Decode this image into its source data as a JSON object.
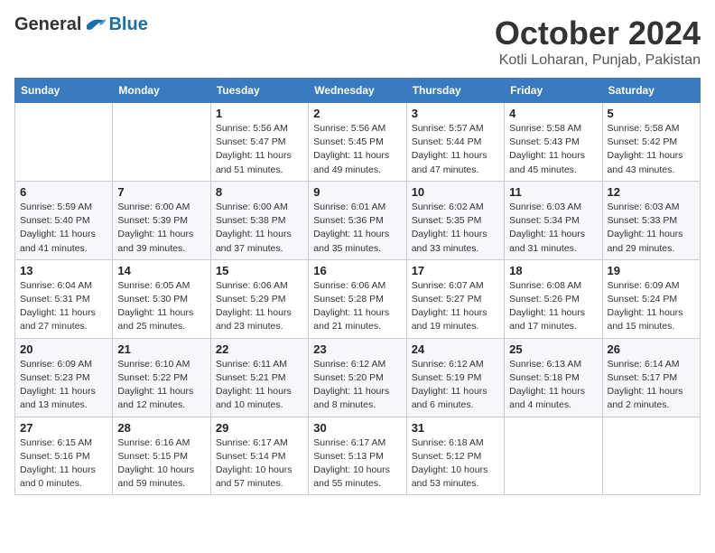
{
  "header": {
    "logo": {
      "general": "General",
      "blue": "Blue"
    },
    "title": "October 2024",
    "location": "Kotli Loharan, Punjab, Pakistan"
  },
  "calendar": {
    "columns": [
      "Sunday",
      "Monday",
      "Tuesday",
      "Wednesday",
      "Thursday",
      "Friday",
      "Saturday"
    ],
    "rows": [
      [
        {
          "day": "",
          "info": ""
        },
        {
          "day": "",
          "info": ""
        },
        {
          "day": "1",
          "info": "Sunrise: 5:56 AM\nSunset: 5:47 PM\nDaylight: 11 hours and 51 minutes."
        },
        {
          "day": "2",
          "info": "Sunrise: 5:56 AM\nSunset: 5:45 PM\nDaylight: 11 hours and 49 minutes."
        },
        {
          "day": "3",
          "info": "Sunrise: 5:57 AM\nSunset: 5:44 PM\nDaylight: 11 hours and 47 minutes."
        },
        {
          "day": "4",
          "info": "Sunrise: 5:58 AM\nSunset: 5:43 PM\nDaylight: 11 hours and 45 minutes."
        },
        {
          "day": "5",
          "info": "Sunrise: 5:58 AM\nSunset: 5:42 PM\nDaylight: 11 hours and 43 minutes."
        }
      ],
      [
        {
          "day": "6",
          "info": "Sunrise: 5:59 AM\nSunset: 5:40 PM\nDaylight: 11 hours and 41 minutes."
        },
        {
          "day": "7",
          "info": "Sunrise: 6:00 AM\nSunset: 5:39 PM\nDaylight: 11 hours and 39 minutes."
        },
        {
          "day": "8",
          "info": "Sunrise: 6:00 AM\nSunset: 5:38 PM\nDaylight: 11 hours and 37 minutes."
        },
        {
          "day": "9",
          "info": "Sunrise: 6:01 AM\nSunset: 5:36 PM\nDaylight: 11 hours and 35 minutes."
        },
        {
          "day": "10",
          "info": "Sunrise: 6:02 AM\nSunset: 5:35 PM\nDaylight: 11 hours and 33 minutes."
        },
        {
          "day": "11",
          "info": "Sunrise: 6:03 AM\nSunset: 5:34 PM\nDaylight: 11 hours and 31 minutes."
        },
        {
          "day": "12",
          "info": "Sunrise: 6:03 AM\nSunset: 5:33 PM\nDaylight: 11 hours and 29 minutes."
        }
      ],
      [
        {
          "day": "13",
          "info": "Sunrise: 6:04 AM\nSunset: 5:31 PM\nDaylight: 11 hours and 27 minutes."
        },
        {
          "day": "14",
          "info": "Sunrise: 6:05 AM\nSunset: 5:30 PM\nDaylight: 11 hours and 25 minutes."
        },
        {
          "day": "15",
          "info": "Sunrise: 6:06 AM\nSunset: 5:29 PM\nDaylight: 11 hours and 23 minutes."
        },
        {
          "day": "16",
          "info": "Sunrise: 6:06 AM\nSunset: 5:28 PM\nDaylight: 11 hours and 21 minutes."
        },
        {
          "day": "17",
          "info": "Sunrise: 6:07 AM\nSunset: 5:27 PM\nDaylight: 11 hours and 19 minutes."
        },
        {
          "day": "18",
          "info": "Sunrise: 6:08 AM\nSunset: 5:26 PM\nDaylight: 11 hours and 17 minutes."
        },
        {
          "day": "19",
          "info": "Sunrise: 6:09 AM\nSunset: 5:24 PM\nDaylight: 11 hours and 15 minutes."
        }
      ],
      [
        {
          "day": "20",
          "info": "Sunrise: 6:09 AM\nSunset: 5:23 PM\nDaylight: 11 hours and 13 minutes."
        },
        {
          "day": "21",
          "info": "Sunrise: 6:10 AM\nSunset: 5:22 PM\nDaylight: 11 hours and 12 minutes."
        },
        {
          "day": "22",
          "info": "Sunrise: 6:11 AM\nSunset: 5:21 PM\nDaylight: 11 hours and 10 minutes."
        },
        {
          "day": "23",
          "info": "Sunrise: 6:12 AM\nSunset: 5:20 PM\nDaylight: 11 hours and 8 minutes."
        },
        {
          "day": "24",
          "info": "Sunrise: 6:12 AM\nSunset: 5:19 PM\nDaylight: 11 hours and 6 minutes."
        },
        {
          "day": "25",
          "info": "Sunrise: 6:13 AM\nSunset: 5:18 PM\nDaylight: 11 hours and 4 minutes."
        },
        {
          "day": "26",
          "info": "Sunrise: 6:14 AM\nSunset: 5:17 PM\nDaylight: 11 hours and 2 minutes."
        }
      ],
      [
        {
          "day": "27",
          "info": "Sunrise: 6:15 AM\nSunset: 5:16 PM\nDaylight: 11 hours and 0 minutes."
        },
        {
          "day": "28",
          "info": "Sunrise: 6:16 AM\nSunset: 5:15 PM\nDaylight: 10 hours and 59 minutes."
        },
        {
          "day": "29",
          "info": "Sunrise: 6:17 AM\nSunset: 5:14 PM\nDaylight: 10 hours and 57 minutes."
        },
        {
          "day": "30",
          "info": "Sunrise: 6:17 AM\nSunset: 5:13 PM\nDaylight: 10 hours and 55 minutes."
        },
        {
          "day": "31",
          "info": "Sunrise: 6:18 AM\nSunset: 5:12 PM\nDaylight: 10 hours and 53 minutes."
        },
        {
          "day": "",
          "info": ""
        },
        {
          "day": "",
          "info": ""
        }
      ]
    ]
  }
}
